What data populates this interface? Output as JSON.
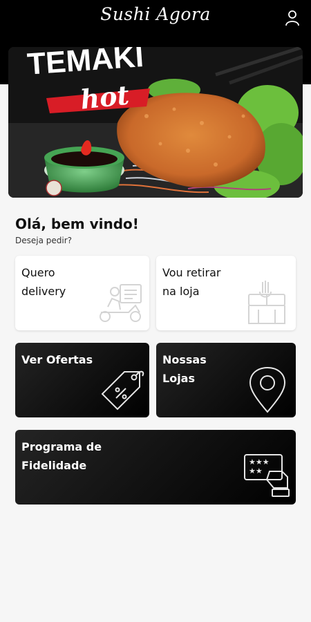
{
  "header": {
    "app_title": "Sushi Agora",
    "user_icon": "user-icon"
  },
  "banner": {
    "headline": "TEMAKI",
    "subline": "hot"
  },
  "greeting": {
    "title": "Olá, bem vindo!",
    "subtitle": "Deseja pedir?"
  },
  "cards": {
    "delivery": {
      "line1": "Quero",
      "line2": "delivery",
      "icon": "delivery-scooter-icon"
    },
    "pickup": {
      "line1": "Vou retirar",
      "line2": "na loja",
      "icon": "store-pickup-icon"
    },
    "offers": {
      "line1": "Ver Ofertas",
      "line2": "",
      "icon": "price-tag-icon"
    },
    "stores": {
      "line1": "Nossas",
      "line2": "Lojas",
      "icon": "map-pin-icon"
    },
    "loyalty": {
      "line1": "Programa de",
      "line2": "Fidelidade",
      "icon": "loyalty-card-icon"
    }
  },
  "colors": {
    "header_bg": "#000000",
    "page_bg": "#f6f6f6",
    "banner_accent": "#e0202a"
  }
}
